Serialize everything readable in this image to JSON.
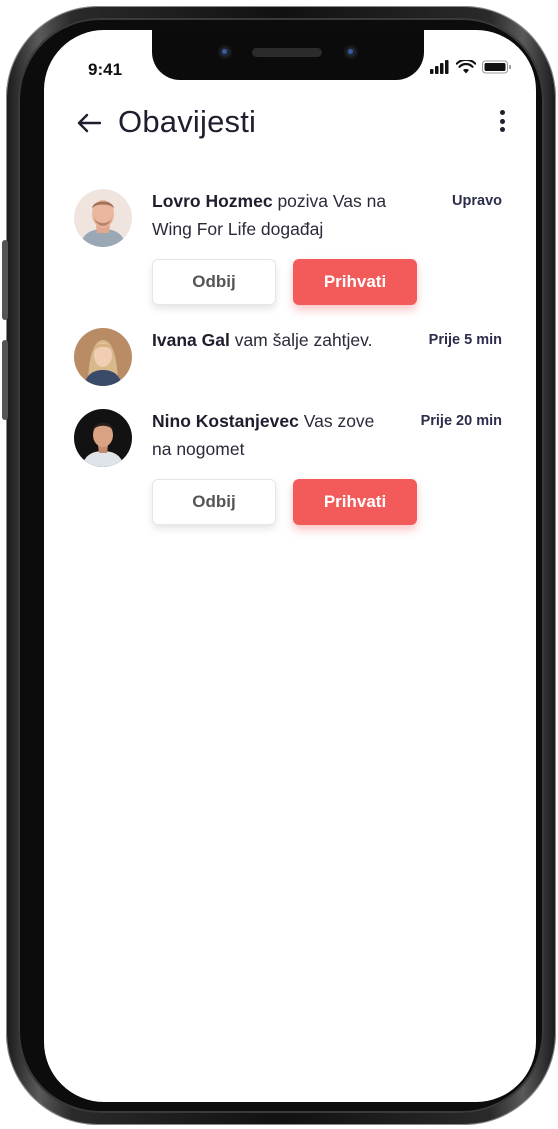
{
  "status_bar": {
    "time": "9:41"
  },
  "header": {
    "title": "Obavijesti"
  },
  "notifications": [
    {
      "name": "Lovro Hozmec",
      "text": " poziva Vas na Wing For Life događaj",
      "time": "Upravo",
      "decline_label": "Odbij",
      "accept_label": "Prihvati"
    },
    {
      "name": "Ivana Gal",
      "text": " vam šalje zahtjev.",
      "time": "Prije 5 min"
    },
    {
      "name": "Nino Kostanjevec",
      "text": " Vas zove na nogomet",
      "time": "Prije 20 min",
      "decline_label": "Odbij",
      "accept_label": "Prihvati"
    }
  ],
  "colors": {
    "accent": "#f35b5b",
    "title": "#1e1e2e"
  }
}
